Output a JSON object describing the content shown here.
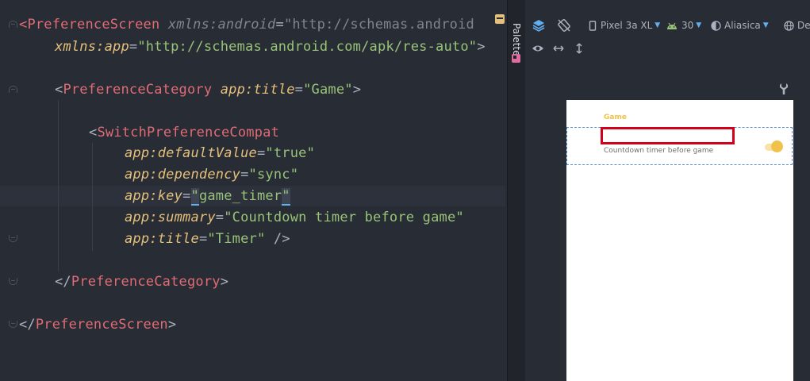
{
  "editor": {
    "lines": {
      "l1": {
        "open": "<",
        "tag": "PreferenceScreen",
        "ns_attr": "xmlns:android",
        "eq": "=",
        "ns_val": "\"http://schemas.android"
      },
      "l2": {
        "ns": "xmlns:",
        "attr": "app",
        "eq": "=",
        "val": "\"http://schemas.android.com/apk/res-auto\"",
        "close": ">"
      },
      "l3": {
        "open": "<",
        "tag": "PreferenceCategory",
        "ns": "app:",
        "attr": "title",
        "eq": "=",
        "val": "\"Game\"",
        "close": ">"
      },
      "l4": {
        "open": "<",
        "tag": "SwitchPreferenceCompat"
      },
      "l5": {
        "ns": "app:",
        "attr": "defaultValue",
        "eq": "=",
        "val": "\"true\""
      },
      "l6": {
        "ns": "app:",
        "attr": "dependency",
        "eq": "=",
        "val": "\"sync\""
      },
      "l7": {
        "ns": "app:",
        "attr": "key",
        "eq": "=",
        "q1": "\"",
        "val": "game_timer",
        "q2": "\""
      },
      "l8": {
        "ns": "app:",
        "attr": "summary",
        "eq": "=",
        "val": "\"Countdown timer before game\""
      },
      "l9": {
        "ns": "app:",
        "attr": "title",
        "eq": "=",
        "val": "\"Timer\"",
        "close": " />"
      },
      "l10": {
        "open": "</",
        "tag": "PreferenceCategory",
        "close": ">"
      },
      "l11": {
        "open": "</",
        "tag": "PreferenceScreen",
        "close": ">"
      }
    }
  },
  "palette": {
    "label": "Palette"
  },
  "toolbar": {
    "device": "Pixel 3a XL",
    "api": "30",
    "theme": "Aliasica",
    "locale": "De"
  },
  "preview": {
    "category": "Game",
    "summary": "Countdown timer before game",
    "switch_on": true
  },
  "colors": {
    "accent": "#f0c24b",
    "selection": "#d0021b",
    "outline": "#5b8dd6"
  }
}
